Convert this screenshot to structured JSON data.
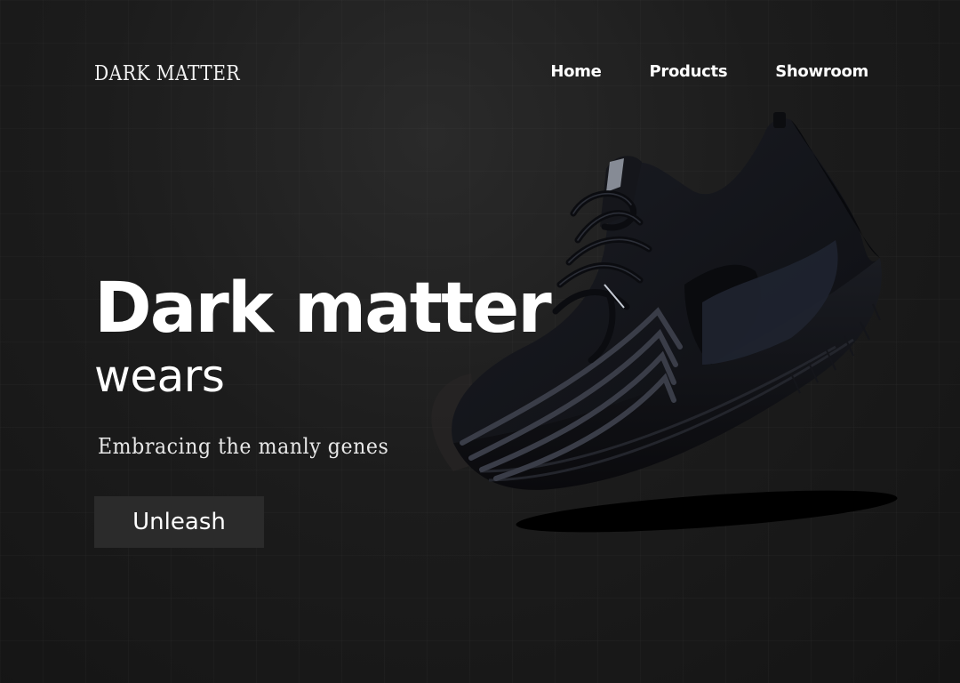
{
  "brand": {
    "logo_text": "DARK MATTER"
  },
  "nav": {
    "items": [
      {
        "label": "Home"
      },
      {
        "label": "Products"
      },
      {
        "label": "Showroom"
      }
    ]
  },
  "hero": {
    "title": "Dark matter",
    "subtitle": "wears",
    "tagline": "Embracing the manly genes",
    "cta_label": "Unleash"
  },
  "colors": {
    "background": "#1c1c1c",
    "button": "#2b2b2b",
    "text": "#ffffff"
  },
  "image": {
    "icon": "sneaker-image"
  }
}
